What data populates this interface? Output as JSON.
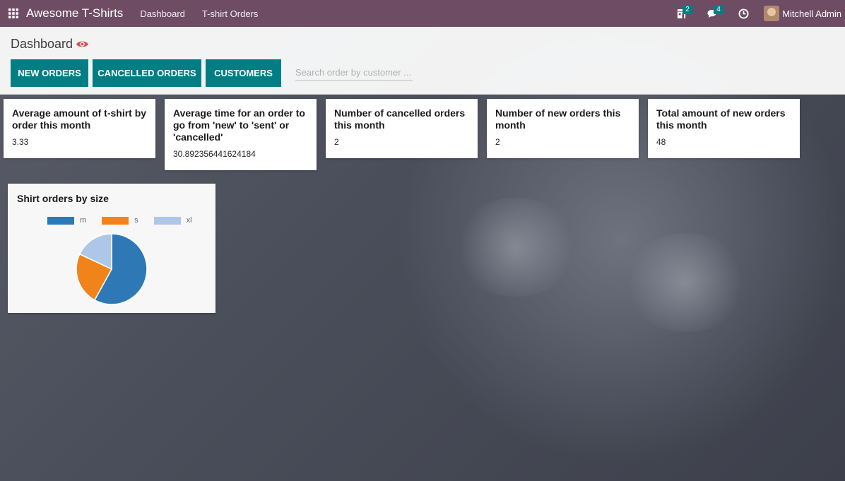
{
  "navbar": {
    "brand": "Awesome T-Shirts",
    "links": [
      "Dashboard",
      "T-shirt Orders"
    ],
    "activity_badge": "2",
    "messages_badge": "4",
    "user_name": "Mitchell Admin"
  },
  "control_panel": {
    "title": "Dashboard",
    "buttons": [
      "NEW ORDERS",
      "CANCELLED ORDERS",
      "CUSTOMERS"
    ],
    "search_placeholder": "Search order by customer ..."
  },
  "stats": [
    {
      "title": "Average amount of t-shirt by order this month",
      "value": "3.33"
    },
    {
      "title": "Average time for an order to go from 'new' to 'sent' or 'cancelled'",
      "value": "30.892356441624184"
    },
    {
      "title": "Number of cancelled orders this month",
      "value": "2"
    },
    {
      "title": "Number of new orders this month",
      "value": "2"
    },
    {
      "title": "Total amount of new orders this month",
      "value": "48"
    }
  ],
  "chart_data": {
    "type": "pie",
    "title": "Shirt orders by size",
    "categories": [
      "m",
      "s",
      "xl"
    ],
    "values": [
      58,
      24,
      18
    ],
    "colors": [
      "#2e79b5",
      "#f0841b",
      "#aec7e8"
    ],
    "legend": "top"
  },
  "colors": {
    "navbar": "#6e4c64",
    "button": "#017e84",
    "eye_icon": "#d9534f"
  }
}
